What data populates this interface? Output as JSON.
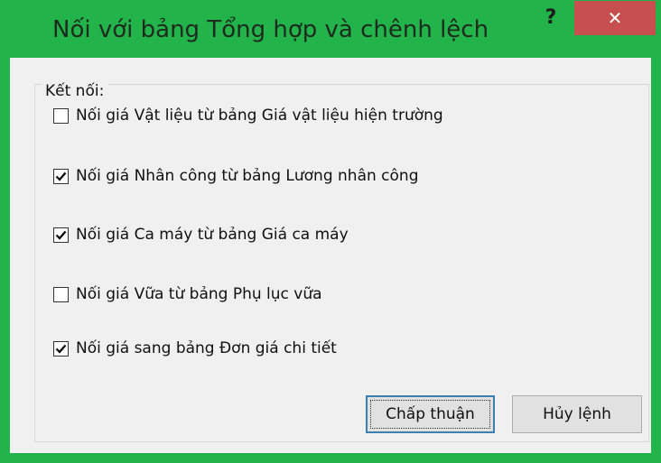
{
  "window": {
    "title": "Nối với bảng Tổng hợp và chênh lệch",
    "help_label": "?",
    "close_label": "✕"
  },
  "group": {
    "label": "Kết nối:"
  },
  "options": [
    {
      "label": "Nối giá Vật liệu từ bảng Giá vật liệu hiện trường",
      "checked": false
    },
    {
      "label": "Nối giá Nhân công từ bảng Lương nhân công",
      "checked": true
    },
    {
      "label": "Nối giá Ca máy từ bảng Giá ca máy",
      "checked": true
    },
    {
      "label": "Nối giá Vữa từ bảng Phụ lục vữa",
      "checked": false
    },
    {
      "label": "Nối giá sang bảng Đơn giá chi tiết",
      "checked": true
    }
  ],
  "buttons": {
    "ok_label": "Chấp thuận",
    "cancel_label": "Hủy lệnh"
  },
  "colors": {
    "title_bar": "#22b34b",
    "close_button": "#c74f4f",
    "client_background": "#f0f0f0"
  }
}
